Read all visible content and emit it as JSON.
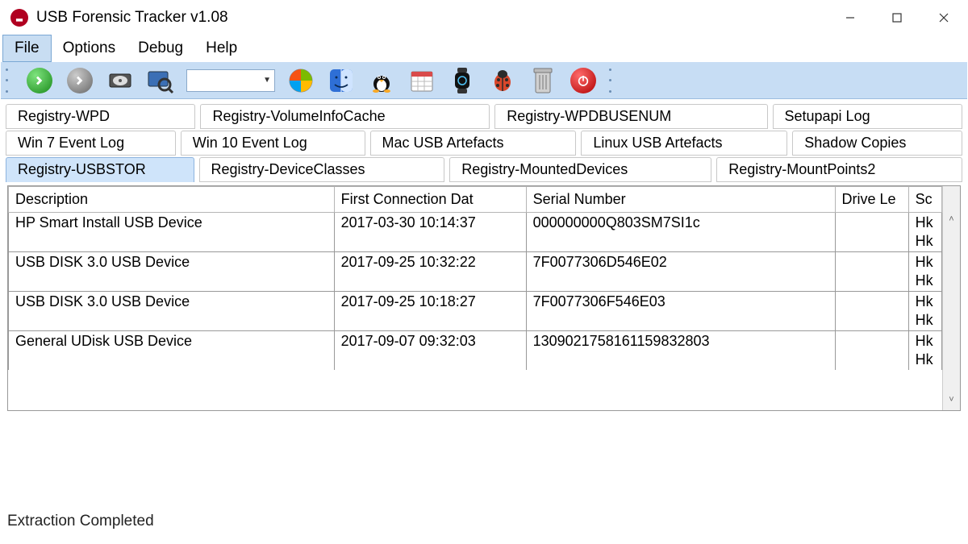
{
  "titlebar": {
    "title": "USB Forensic Tracker v1.08"
  },
  "menubar": {
    "file": "File",
    "options": "Options",
    "debug": "Debug",
    "help": "Help"
  },
  "tabs": {
    "row1": [
      "Registry-WPD",
      "Registry-VolumeInfoCache",
      "Registry-WPDBUSENUM",
      "Setupapi Log"
    ],
    "row2": [
      "Win 7 Event Log",
      "Win 10 Event Log",
      "Mac USB Artefacts",
      "Linux USB Artefacts",
      "Shadow Copies"
    ],
    "row3": [
      "Registry-USBSTOR",
      "Registry-DeviceClasses",
      "Registry-MountedDevices",
      "Registry-MountPoints2"
    ],
    "active": "Registry-USBSTOR"
  },
  "columns": {
    "description": "Description",
    "first_connection": "First Connection Dat",
    "serial": "Serial Number",
    "drive": "Drive Le",
    "sc": "Sc"
  },
  "rows": [
    {
      "description": "HP Smart Install USB Device",
      "date": "2017-03-30 10:14:37",
      "serial": "000000000Q803SM7SI1c",
      "drive": "",
      "sc1": "Hk",
      "sc2": "Hk"
    },
    {
      "description": "USB DISK 3.0 USB Device",
      "date": "2017-09-25 10:32:22",
      "serial": "7F0077306D546E02",
      "drive": "",
      "sc1": "Hk",
      "sc2": "Hk"
    },
    {
      "description": "USB DISK 3.0 USB Device",
      "date": "2017-09-25 10:18:27",
      "serial": "7F0077306F546E03",
      "drive": "",
      "sc1": "Hk",
      "sc2": "Hk"
    },
    {
      "description": "General UDisk USB Device",
      "date": "2017-09-07 09:32:03",
      "serial": "1309021758161159832803",
      "drive": "",
      "sc1": "Hk",
      "sc2": "Hk"
    }
  ],
  "statusbar": {
    "text": "Extraction Completed"
  }
}
